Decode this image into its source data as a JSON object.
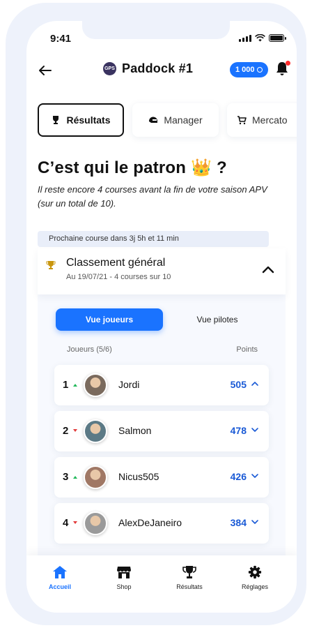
{
  "status_bar": {
    "time": "9:41"
  },
  "header": {
    "title": "Paddock #1",
    "logo_text": "GPS",
    "credits": "1 000"
  },
  "tabs": [
    {
      "label": "Résultats",
      "icon": "trophy-icon"
    },
    {
      "label": "Manager",
      "icon": "helmet-icon"
    },
    {
      "label": "Mercato",
      "icon": "cart-icon"
    }
  ],
  "main": {
    "headline": "C’est qui le patron 👑 ?",
    "subtitle": "Il reste encore 4 courses avant la fin de votre saison APV (sur un total de 10).",
    "next_race": "Prochaine course dans 3j 5h et 11 min"
  },
  "ranking": {
    "title": "Classement général",
    "subtitle": "Au 19/07/21 - 4 courses sur 10",
    "toggle": {
      "players": "Vue joueurs",
      "drivers": "Vue pilotes"
    },
    "columns": {
      "players": "Joueurs (5/6)",
      "points": "Points"
    },
    "rows": [
      {
        "rank": "1",
        "trend": "up",
        "name": "Jordi",
        "points": "505",
        "expanded": true,
        "avatar_color": "#7a6a5d"
      },
      {
        "rank": "2",
        "trend": "down",
        "name": "Salmon",
        "points": "478",
        "expanded": false,
        "avatar_color": "#5c7a86"
      },
      {
        "rank": "3",
        "trend": "up",
        "name": "Nicus505",
        "points": "426",
        "expanded": false,
        "avatar_color": "#a07865"
      },
      {
        "rank": "4",
        "trend": "down",
        "name": "AlexDeJaneiro",
        "points": "384",
        "expanded": false,
        "avatar_color": "#9a9a9a"
      }
    ]
  },
  "bottom_nav": [
    {
      "label": "Accueil",
      "icon": "home-icon",
      "active": true
    },
    {
      "label": "Shop",
      "icon": "shop-icon",
      "active": false
    },
    {
      "label": "Résultats",
      "icon": "trophy-icon",
      "active": false
    },
    {
      "label": "Réglages",
      "icon": "gear-icon",
      "active": false
    }
  ],
  "colors": {
    "accent": "#1a73ff",
    "points": "#1a5ad6",
    "up": "#22b85a",
    "down": "#e23a3a"
  }
}
